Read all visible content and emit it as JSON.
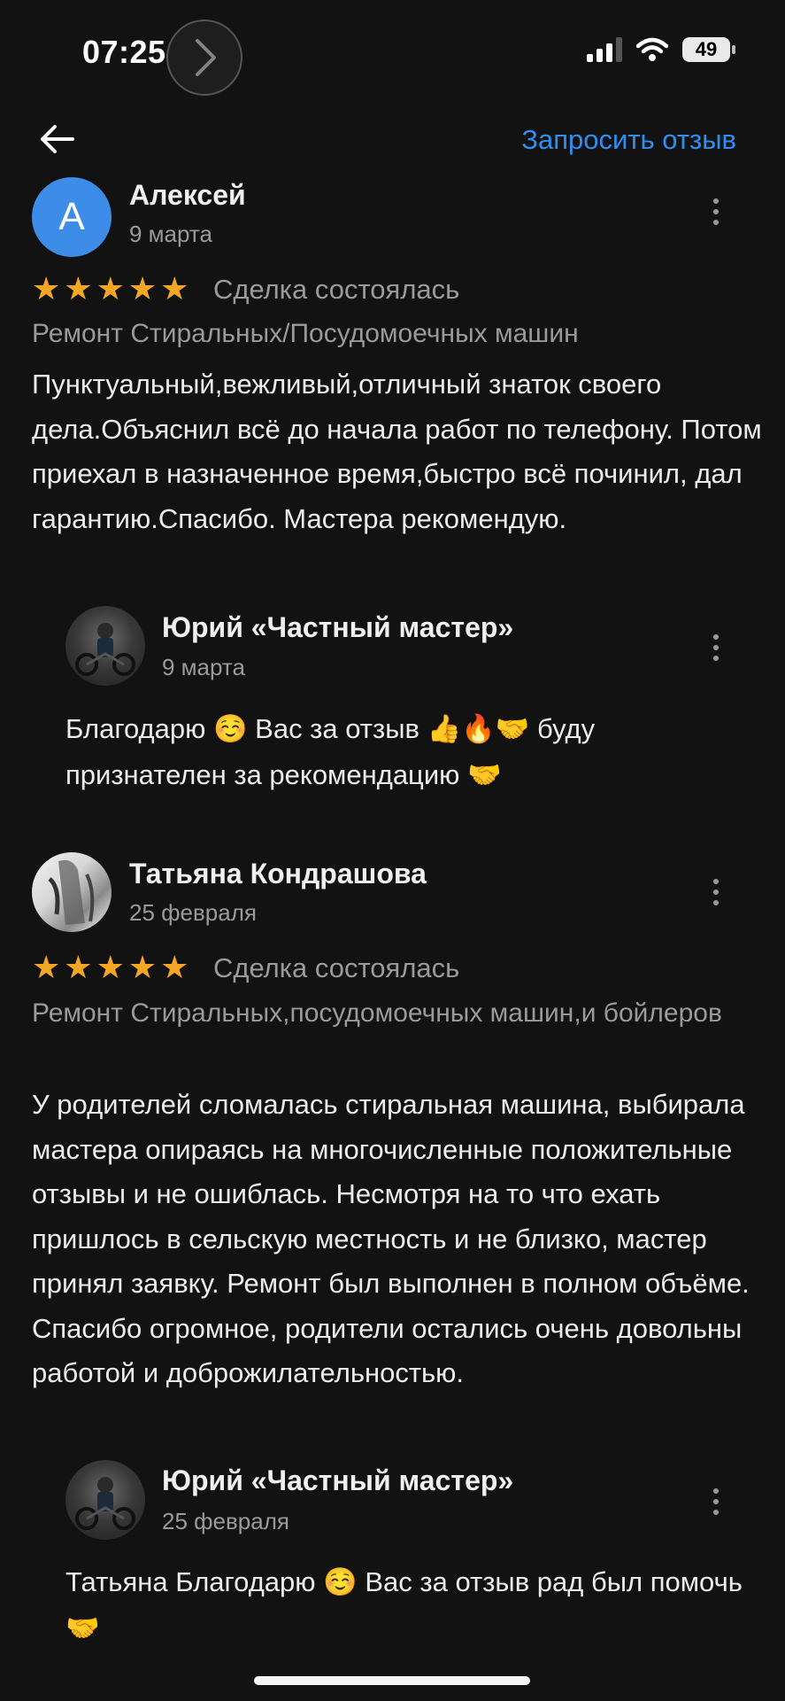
{
  "status_bar": {
    "time": "07:25",
    "battery": "49"
  },
  "header": {
    "request_review_label": "Запросить отзыв"
  },
  "reviews": [
    {
      "avatar_letter": "А",
      "author": "Алексей",
      "date": "9 марта",
      "rating": 5,
      "deal_status": "Сделка состоялась",
      "category": "Ремонт Стиральных/Посудомоечных машин",
      "text": "Пунктуальный,вежливый,отличный знаток своего дела.Объяснил всё до начала работ по телефону. Потом приехал в назначенное время,быстро всё починил, дал гарантию.Спасибо. Мастера рекомендую.",
      "reply": {
        "author": "Юрий  «Частный мастер»",
        "date": "9 марта",
        "text": "Благодарю ☺️ Вас за отзыв 👍🔥🤝 буду признателен за рекомендацию 🤝"
      }
    },
    {
      "author": "Татьяна Кондрашова",
      "date": "25 февраля",
      "rating": 5,
      "deal_status": "Сделка состоялась",
      "category": "Ремонт Стиральных,посудомоечных машин,и бойлеров",
      "text": "У родителей сломалась стиральная машина, выбирала мастера опираясь на многочисленные положительные отзывы и не ошиблась. Несмотря на то что ехать пришлось в сельскую местность и не близко, мастер принял заявку. Ремонт был выполнен в полном объёме. Спасибо огромное, родители остались очень довольны работой и доброжилательностью.",
      "reply": {
        "author": "Юрий  «Частный мастер»",
        "date": "25 февраля",
        "text": "Татьяна Благодарю ☺️ Вас за отзыв рад был помочь 🤝"
      }
    }
  ],
  "colors": {
    "accent": "#2f8ff0",
    "star": "#f5a623",
    "background": "#121212"
  }
}
